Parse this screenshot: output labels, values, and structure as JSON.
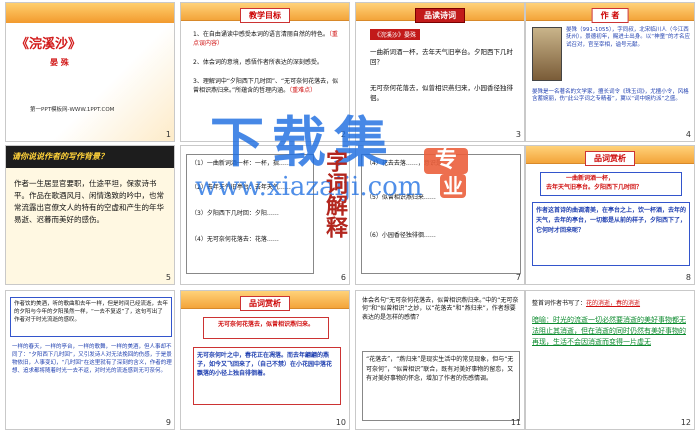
{
  "slides": [
    {
      "num": "1",
      "title": "《浣溪沙》",
      "author": "晏 殊",
      "footer": "第一PPT模板网-WWW.1PPT.COM"
    },
    {
      "num": "2",
      "heading": "教学目标",
      "g1a": "1、在自由诵读中感受本词的语言清丽自然的特色。",
      "g1b": "（重点误内容）",
      "g2": "2、体会词的意境，感悟作者所表达的深刻感受。",
      "g3a": "3、理解词中“夕阳西下几时回”、“无可奈何花落去，似曾相识燕归来。”所蕴含的哲理内涵。",
      "g3b": "（重难点）"
    },
    {
      "num": "3",
      "heading": "品读诗词",
      "subtitle": "《浣溪沙》晏殊",
      "l1": "一曲新词酒一杯，去年天气旧亭台。夕阳西下几时回？",
      "l2": "无可奈何花落去，似曾相识燕归来，小园香径独徘徊。"
    },
    {
      "num": "4",
      "heading": "作 者",
      "p1": "晏殊（991-1055），字同叔，北宋临川人（今江西抚州）。景德初年，赐进士出身。以“神童”的才名应试召对，官至宰相，谥号元献。",
      "p2": "晏殊是一名著名的文学家，擅长词令《珠玉词》，尤擅小令，风格含蓄婉丽，伤“此公字词之专精者”，翼以“词中婉约派”之盛。"
    },
    {
      "num": "5",
      "banner": "请你说说作者的写作背景？",
      "body": "作者一生居显官要职，仕途平坦，保家诗书平。作品在歌酒风月、闲情逸致的吟中，也常常流露出官僚文人的特有的空虚和产生的年华易逝、迟暮而美好的感伤。"
    },
    {
      "num": "6",
      "l1": "（1）一曲新词酒一杯：一杯，指……",
      "l2": "（2）去年天气旧亭台：去年天气……",
      "l3": "（3）夕阳西下几时回：夕阳……",
      "l4": "（4）无可奈何花落去：花落……",
      "side": "字词解释"
    },
    {
      "num": "7",
      "l1": "（4）花去去落……，意识是……",
      "l2": "（5）似曾相识燕归来……",
      "l3": "（6）小园香径独徘徊……"
    },
    {
      "num": "8",
      "heading": "品词赏析",
      "quote1": "一曲新词酒一杯，",
      "quote2": "去年天气旧亭台。夕阳西下几时回？",
      "body": "作者这首诗的曲调清美，在亭台之上，饮一杯酒，去年的天气，去年的亭台，一切都是从前的样子，夕阳西下了，它何时才回来呢？"
    },
    {
      "num": "9",
      "top": "作者饮的美酒，听的歌曲和去年一样，但是时间已经流逝，去年的夕阳与今年的夕阳虽然一样，“一去不复返”了，这句写出了作者对于时光流逝的感叹。",
      "body": "一样的春天，一样的亭台，一样的歌舞，一样的美酒，但人事却不同了：“夕阳西下几时回”，又引发诗人对无法挽回的伤感，于是景物依旧，人事变幻，“几时回”在这里就有了深刻的含义，作者的理想、追求都将随着时光一去不返，对时光的流逝感到无可奈何。"
    },
    {
      "num": "10",
      "heading": "品词赏析",
      "quote": "无可奈何花落去，似曾相识燕归来。",
      "body": "无可奈何叶之中，春花正在凋落。而去年翩翩的燕子，如今又飞回来了，（自己不禁）在小花园中落花飘落的小径上独自徘徊着。"
    },
    {
      "num": "11",
      "q": "体会名句“无可奈何花落去，似曾相识燕归来。”中的“无可奈何”和“似曾相识”之妙，以“花落去”和“燕归来”，作者想要表达的是怎样的感情？",
      "a": "“花落去”，“燕归来”是现实生活中的常见现象，但与“无可奈何”，“似曾相识”联合，既有对美好事物的留恋，又有对美好事物的怀念，增加了作者的伤感情调。"
    },
    {
      "num": "12",
      "b1a": "整首词作者书写了：",
      "b1b": "花的消逝，春的消逝",
      "b2": "暗喻：时光的流逝一切必然要消逝的美好事物都无法阻止其消逝，但在消逝的同时仍然有美好事物的再现，生活不会因消逝而变得一片虚无"
    }
  ],
  "watermark": {
    "big": "下载集",
    "url": "www.xiazaiji.com",
    "badge1": "专",
    "badge2": "业"
  }
}
